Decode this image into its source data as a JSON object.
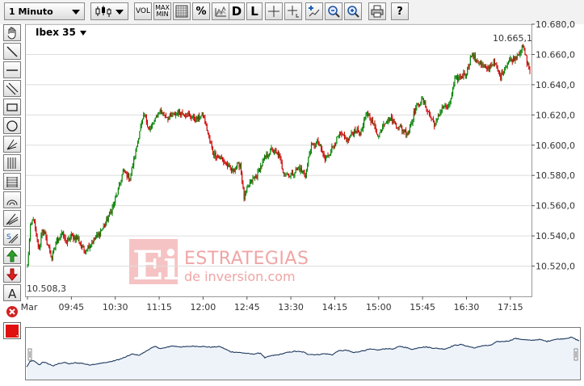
{
  "toolbar": {
    "interval_label": "1 Minuto",
    "vol_label": "VOL",
    "maxmin_label_top": "MAX",
    "maxmin_label_bottom": "MIN",
    "percent_label": "%",
    "d_label": "D",
    "l_label": "L",
    "help_label": "?"
  },
  "chart_data": {
    "type": "candlestick",
    "instrument": "Ibex 35",
    "last_value_label": "10.665,1",
    "low_value_label": "10.508,3",
    "ylim": [
      10500,
      10680
    ],
    "y_ticks": [
      10680,
      10660,
      10640,
      10620,
      10600,
      10580,
      10560,
      10540,
      10520
    ],
    "y_tick_labels": [
      "10.680,0",
      "10.660,0",
      "10.640,0",
      "10.620,0",
      "10.600,0",
      "10.580,0",
      "10.560,0",
      "10.540,0",
      "10.520,0"
    ],
    "x_tick_labels": [
      "Mar",
      "09:45",
      "10:30",
      "11:15",
      "12:00",
      "12:45",
      "13:30",
      "14:15",
      "15:00",
      "15:45",
      "16:30",
      "17:15"
    ],
    "grid": true,
    "colors": {
      "up": "#008000",
      "down": "#cc0000",
      "grid": "#dddddd",
      "navigator_line": "#1f3a5f"
    },
    "series_points": [
      [
        "09:00",
        10520
      ],
      [
        "09:03",
        10545
      ],
      [
        "09:06",
        10552
      ],
      [
        "09:09",
        10540
      ],
      [
        "09:12",
        10530
      ],
      [
        "09:15",
        10545
      ],
      [
        "09:20",
        10536
      ],
      [
        "09:25",
        10525
      ],
      [
        "09:30",
        10537
      ],
      [
        "09:35",
        10542
      ],
      [
        "09:40",
        10535
      ],
      [
        "09:45",
        10540
      ],
      [
        "09:52",
        10538
      ],
      [
        "09:58",
        10530
      ],
      [
        "10:05",
        10535
      ],
      [
        "10:12",
        10540
      ],
      [
        "10:20",
        10548
      ],
      [
        "10:28",
        10560
      ],
      [
        "10:33",
        10570
      ],
      [
        "10:38",
        10583
      ],
      [
        "10:45",
        10578
      ],
      [
        "10:50",
        10593
      ],
      [
        "10:55",
        10610
      ],
      [
        "11:00",
        10620
      ],
      [
        "11:05",
        10610
      ],
      [
        "11:10",
        10615
      ],
      [
        "11:15",
        10623
      ],
      [
        "11:25",
        10618
      ],
      [
        "11:35",
        10622
      ],
      [
        "11:45",
        10620
      ],
      [
        "11:52",
        10617
      ],
      [
        "12:00",
        10620
      ],
      [
        "12:05",
        10608
      ],
      [
        "12:10",
        10595
      ],
      [
        "12:20",
        10590
      ],
      [
        "12:30",
        10583
      ],
      [
        "12:38",
        10588
      ],
      [
        "12:42",
        10565
      ],
      [
        "12:48",
        10575
      ],
      [
        "12:55",
        10580
      ],
      [
        "13:02",
        10590
      ],
      [
        "13:10",
        10597
      ],
      [
        "13:18",
        10593
      ],
      [
        "13:22",
        10583
      ],
      [
        "13:30",
        10580
      ],
      [
        "13:38",
        10585
      ],
      [
        "13:45",
        10580
      ],
      [
        "13:50",
        10598
      ],
      [
        "13:58",
        10602
      ],
      [
        "14:05",
        10590
      ],
      [
        "14:12",
        10598
      ],
      [
        "14:20",
        10607
      ],
      [
        "14:28",
        10603
      ],
      [
        "14:35",
        10610
      ],
      [
        "14:42",
        10608
      ],
      [
        "14:48",
        10622
      ],
      [
        "14:55",
        10613
      ],
      [
        "15:00",
        10606
      ],
      [
        "15:05",
        10615
      ],
      [
        "15:12",
        10618
      ],
      [
        "15:20",
        10612
      ],
      [
        "15:30",
        10608
      ],
      [
        "15:38",
        10625
      ],
      [
        "15:45",
        10630
      ],
      [
        "15:52",
        10620
      ],
      [
        "15:58",
        10613
      ],
      [
        "16:05",
        10625
      ],
      [
        "16:12",
        10625
      ],
      [
        "16:18",
        10643
      ],
      [
        "16:24",
        10645
      ],
      [
        "16:30",
        10648
      ],
      [
        "16:35",
        10660
      ],
      [
        "16:42",
        10655
      ],
      [
        "16:50",
        10650
      ],
      [
        "16:58",
        10655
      ],
      [
        "17:05",
        10645
      ],
      [
        "17:12",
        10655
      ],
      [
        "17:20",
        10658
      ],
      [
        "17:28",
        10665
      ],
      [
        "17:35",
        10648
      ]
    ]
  }
}
